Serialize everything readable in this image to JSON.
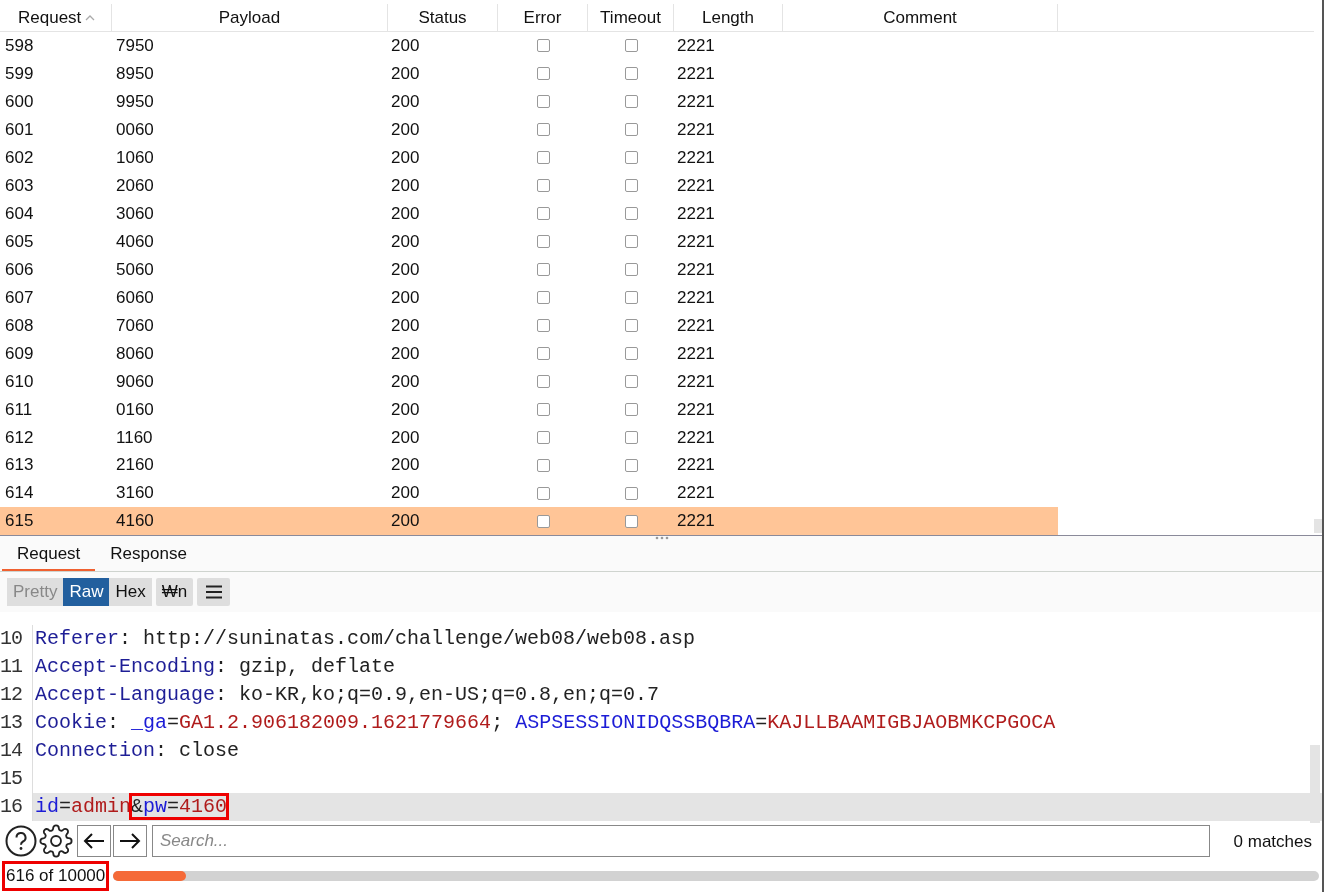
{
  "table": {
    "columns": [
      {
        "label": "Request",
        "sorted": true
      },
      {
        "label": "Payload",
        "sorted": false
      },
      {
        "label": "Status",
        "sorted": false
      },
      {
        "label": "Error",
        "sorted": false
      },
      {
        "label": "Timeout",
        "sorted": false
      },
      {
        "label": "Length",
        "sorted": false
      },
      {
        "label": "Comment",
        "sorted": false
      }
    ],
    "rows": [
      {
        "request": "598",
        "payload": "7950",
        "status": "200",
        "error": false,
        "timeout": false,
        "length": "2221",
        "selected": false
      },
      {
        "request": "599",
        "payload": "8950",
        "status": "200",
        "error": false,
        "timeout": false,
        "length": "2221",
        "selected": false
      },
      {
        "request": "600",
        "payload": "9950",
        "status": "200",
        "error": false,
        "timeout": false,
        "length": "2221",
        "selected": false
      },
      {
        "request": "601",
        "payload": "0060",
        "status": "200",
        "error": false,
        "timeout": false,
        "length": "2221",
        "selected": false
      },
      {
        "request": "602",
        "payload": "1060",
        "status": "200",
        "error": false,
        "timeout": false,
        "length": "2221",
        "selected": false
      },
      {
        "request": "603",
        "payload": "2060",
        "status": "200",
        "error": false,
        "timeout": false,
        "length": "2221",
        "selected": false
      },
      {
        "request": "604",
        "payload": "3060",
        "status": "200",
        "error": false,
        "timeout": false,
        "length": "2221",
        "selected": false
      },
      {
        "request": "605",
        "payload": "4060",
        "status": "200",
        "error": false,
        "timeout": false,
        "length": "2221",
        "selected": false
      },
      {
        "request": "606",
        "payload": "5060",
        "status": "200",
        "error": false,
        "timeout": false,
        "length": "2221",
        "selected": false
      },
      {
        "request": "607",
        "payload": "6060",
        "status": "200",
        "error": false,
        "timeout": false,
        "length": "2221",
        "selected": false
      },
      {
        "request": "608",
        "payload": "7060",
        "status": "200",
        "error": false,
        "timeout": false,
        "length": "2221",
        "selected": false
      },
      {
        "request": "609",
        "payload": "8060",
        "status": "200",
        "error": false,
        "timeout": false,
        "length": "2221",
        "selected": false
      },
      {
        "request": "610",
        "payload": "9060",
        "status": "200",
        "error": false,
        "timeout": false,
        "length": "2221",
        "selected": false
      },
      {
        "request": "611",
        "payload": "0160",
        "status": "200",
        "error": false,
        "timeout": false,
        "length": "2221",
        "selected": false
      },
      {
        "request": "612",
        "payload": "1160",
        "status": "200",
        "error": false,
        "timeout": false,
        "length": "2221",
        "selected": false
      },
      {
        "request": "613",
        "payload": "2160",
        "status": "200",
        "error": false,
        "timeout": false,
        "length": "2221",
        "selected": false
      },
      {
        "request": "614",
        "payload": "3160",
        "status": "200",
        "error": false,
        "timeout": false,
        "length": "2221",
        "selected": false
      },
      {
        "request": "615",
        "payload": "4160",
        "status": "200",
        "error": false,
        "timeout": false,
        "length": "2221",
        "selected": true
      }
    ]
  },
  "tabs": [
    {
      "label": "Request",
      "selected": true
    },
    {
      "label": "Response",
      "selected": false
    }
  ],
  "view_buttons": [
    {
      "label": "Pretty",
      "selected": false
    },
    {
      "label": "Raw",
      "selected": true
    },
    {
      "label": "Hex",
      "selected": false
    },
    {
      "label": "₩n",
      "selected": false
    }
  ],
  "editor": {
    "lines": [
      {
        "number": "10",
        "current": false,
        "segments": [
          {
            "kind": "header",
            "text": "Referer"
          },
          {
            "kind": "plain",
            "text": ": http://suninatas.com/challenge/web08/web08.asp"
          }
        ]
      },
      {
        "number": "11",
        "current": false,
        "segments": [
          {
            "kind": "header",
            "text": "Accept-Encoding"
          },
          {
            "kind": "plain",
            "text": ": gzip, deflate"
          }
        ]
      },
      {
        "number": "12",
        "current": false,
        "segments": [
          {
            "kind": "header",
            "text": "Accept-Language"
          },
          {
            "kind": "plain",
            "text": ": ko-KR,ko;q=0.9,en-US;q=0.8,en;q=0.7"
          }
        ]
      },
      {
        "number": "13",
        "current": false,
        "segments": [
          {
            "kind": "header",
            "text": "Cookie"
          },
          {
            "kind": "plain",
            "text": ": "
          },
          {
            "kind": "name",
            "text": "_ga"
          },
          {
            "kind": "plain",
            "text": "="
          },
          {
            "kind": "value",
            "text": "GA1.2.906182009.1621779664"
          },
          {
            "kind": "plain",
            "text": "; "
          },
          {
            "kind": "name",
            "text": "ASPSESSIONIDQSSBQBRA"
          },
          {
            "kind": "plain",
            "text": "="
          },
          {
            "kind": "value",
            "text": "KAJLLBAAMIGBJAOBMKCPGOCA"
          }
        ]
      },
      {
        "number": "14",
        "current": false,
        "segments": [
          {
            "kind": "header",
            "text": "Connection"
          },
          {
            "kind": "plain",
            "text": ": close"
          }
        ]
      },
      {
        "number": "15",
        "current": false
      },
      {
        "number": "16",
        "current": true,
        "segments": [
          {
            "kind": "name",
            "text": "id"
          },
          {
            "kind": "plain",
            "text": "="
          },
          {
            "kind": "value",
            "text": "admin"
          }
        ],
        "boxed_segments": [
          {
            "kind": "plain",
            "text": "&"
          },
          {
            "kind": "name",
            "text": "pw"
          },
          {
            "kind": "plain",
            "text": "="
          },
          {
            "kind": "value",
            "text": "4160"
          }
        ]
      }
    ]
  },
  "search": {
    "placeholder": "Search...",
    "matches": "0 matches"
  },
  "progress": {
    "text": "616 of 10000",
    "boxed": true,
    "level": 0.06
  }
}
